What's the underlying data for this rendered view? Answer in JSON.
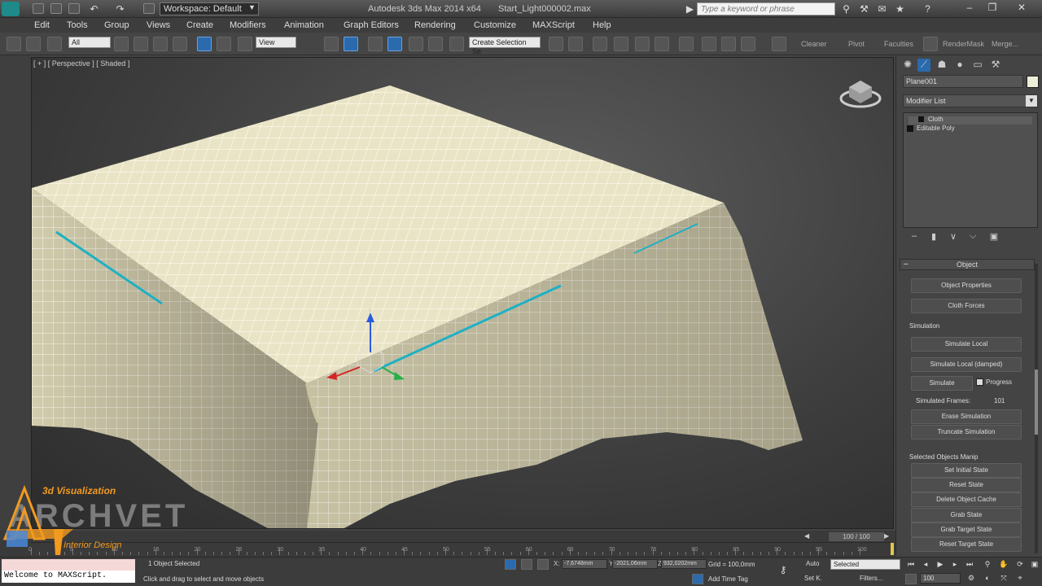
{
  "title_bar": {
    "workspace": "Workspace: Default",
    "app_title": "Autodesk 3ds Max  2014 x64",
    "file_name": "Start_Light000002.max",
    "search_placeholder": "Type a keyword or phrase"
  },
  "menu": [
    "Edit",
    "Tools",
    "Group",
    "Views",
    "Create",
    "Modifiers",
    "Animation",
    "Graph Editors",
    "Rendering",
    "Customize",
    "MAXScript",
    "Help"
  ],
  "main_toolbar": {
    "selection_filter": "All",
    "reference_coord": "View",
    "named_selection": "Create Selection Se",
    "labels": [
      "Cleaner",
      "Pivot",
      "Faculties",
      "RenderMask",
      "Merge..."
    ]
  },
  "viewport": {
    "label": "[ + ] [ Perspective ] [ Shaded ]",
    "gizmo_colors": {
      "x": "#d22626",
      "y": "#27b04a",
      "z": "#2a5be0"
    }
  },
  "command_panel": {
    "object_name": "Plane001",
    "object_color": "#efeed8",
    "modifier_list": "Modifier List",
    "stack": [
      "Cloth",
      "Editable Poly"
    ],
    "rollout": "Object",
    "buttons_top": [
      "Object Properties",
      "Cloth Forces"
    ],
    "simulation_group": "Simulation",
    "simulation_buttons": [
      "Simulate Local",
      "Simulate Local (damped)"
    ],
    "simulate": "Simulate",
    "progress": "Progress",
    "simulated_frames_label": "Simulated Frames:",
    "simulated_frames_value": "101",
    "simulation_buttons_2": [
      "Erase Simulation",
      "Truncate Simulation"
    ],
    "selected_group": "Selected Objects Manip",
    "selected_buttons": [
      "Set Initial State",
      "Reset State",
      "Delete Object Cache",
      "Grab State",
      "Grab Target State",
      "Reset Target State"
    ]
  },
  "timeline": {
    "frame_display": "100 / 100",
    "ticks": [
      "0",
      "5",
      "10",
      "15",
      "20",
      "25",
      "30",
      "35",
      "40",
      "45",
      "50",
      "55",
      "60",
      "65",
      "70",
      "75",
      "80",
      "85",
      "90",
      "95",
      "100"
    ]
  },
  "logo": {
    "title": "3d Visualization",
    "brand": "ARCHVET",
    "subtitle": "Interior Design"
  },
  "status": {
    "maxscript": "Welcome to MAXScript.",
    "selection": "1 Object Selected",
    "prompt": "Click and drag to select and move objects",
    "x_label": "X:",
    "y_label": "Y:",
    "z_label": "Z:",
    "x": "-7,6748mm",
    "y": "-2021,06mm",
    "z": "932,0202mm",
    "grid": "Grid = 100,0mm",
    "add_time_tag": "Add Time Tag",
    "auto": "Auto",
    "set_key": "Set K.",
    "selected_dropdown": "Selected",
    "filters": "Filters...",
    "current_frame": "100"
  }
}
